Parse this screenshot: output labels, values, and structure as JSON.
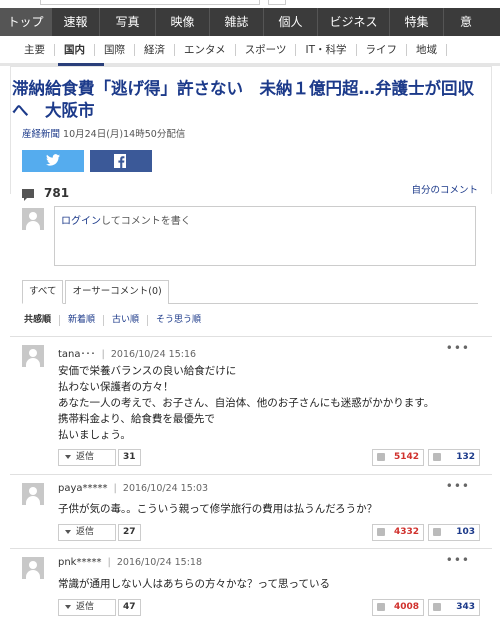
{
  "main_nav": [
    "トップ",
    "速報",
    "写真",
    "映像",
    "雑誌",
    "個人",
    "ビジネス",
    "特集",
    "意"
  ],
  "sub_nav": [
    "主要",
    "国内",
    "国際",
    "経済",
    "エンタメ",
    "スポーツ",
    "IT・科学",
    "ライフ",
    "地域"
  ],
  "article": {
    "headline": "滞納給食費「逃げ得」許さない　未納１億円超…弁護士が回収へ　大阪市",
    "publisher": "産経新聞",
    "datetime": "10月24日(月)14時50分配信"
  },
  "comments_section": {
    "count": "781",
    "my_comments": "自分のコメント",
    "compose_login": "ログイン",
    "compose_rest": "してコメントを書く",
    "tabs": [
      "すべて",
      "オーサーコメント(0)"
    ],
    "sorts": [
      "共感順",
      "新着順",
      "古い順",
      "そう思う順"
    ]
  },
  "comments": [
    {
      "user": "tana･･･",
      "time": "2016/10/24 15:16",
      "more": "•••",
      "lines": [
        "安価で栄養バランスの良い給食だけに",
        "払わない保護者の方々！",
        "あなた一人の考えで、お子さん、自治体、他のお子さんにも迷惑がかかります。",
        "携帯料金より、給食費を最優先で",
        "払いましょう。"
      ],
      "reply_label": "返信",
      "reply_count": "31",
      "up": "5142",
      "down": "132"
    },
    {
      "user": "paya*****",
      "time": "2016/10/24 15:03",
      "more": "•••",
      "lines": [
        "子供が気の毒。。こういう親って修学旅行の費用は払うんだろうか？"
      ],
      "reply_label": "返信",
      "reply_count": "27",
      "up": "4332",
      "down": "103"
    },
    {
      "user": "pnk*****",
      "time": "2016/10/24 15:18",
      "more": "•••",
      "lines": [
        "常識が通用しない人はあちらの方々かな？って思っている"
      ],
      "reply_label": "返信",
      "reply_count": "47",
      "up": "4008",
      "down": "343"
    }
  ],
  "colors": {
    "nav_bg": "#3b3b3b",
    "link": "#1c3a8a",
    "twitter": "#55acee",
    "facebook": "#3b5998",
    "up_vote": "#d0312d"
  }
}
